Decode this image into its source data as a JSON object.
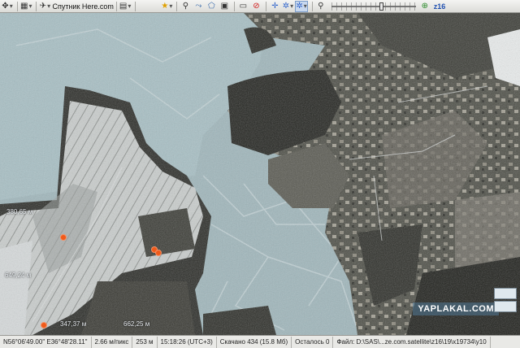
{
  "toolbar": {
    "provider_label": "Спутник Here.com",
    "zoom_label": "z16",
    "zoom_fraction": 0.6
  },
  "icons": [
    "move-icon",
    "grid-icon",
    "satellite-icon",
    "layers-icon",
    "star-icon",
    "placemark-icon",
    "path-icon",
    "polygon-icon",
    "camera-icon",
    "no-entry-icon",
    "target-icon",
    "gps-icon",
    "search-icon"
  ],
  "map": {
    "labels": [
      {
        "text": "380,65 м"
      },
      {
        "text": "649,24 м"
      },
      {
        "text": "347,37 м"
      },
      {
        "text": "662,25 м"
      }
    ],
    "watermark": "YAPLAKAL.COM"
  },
  "statusbar": {
    "coords": "N56°06'49.00\" E36°48'28.11\"",
    "scale": "2.66 м/пикс",
    "altitude": "253 м",
    "time": "15:18:26 (UTC+3)",
    "downloaded": "Скачано 434 (15.8 Мб)",
    "remaining": "Осталось 0",
    "file": "Файл: D:\\SAS\\...ze.com.satellite\\z16\\19\\x19734\\y10"
  }
}
